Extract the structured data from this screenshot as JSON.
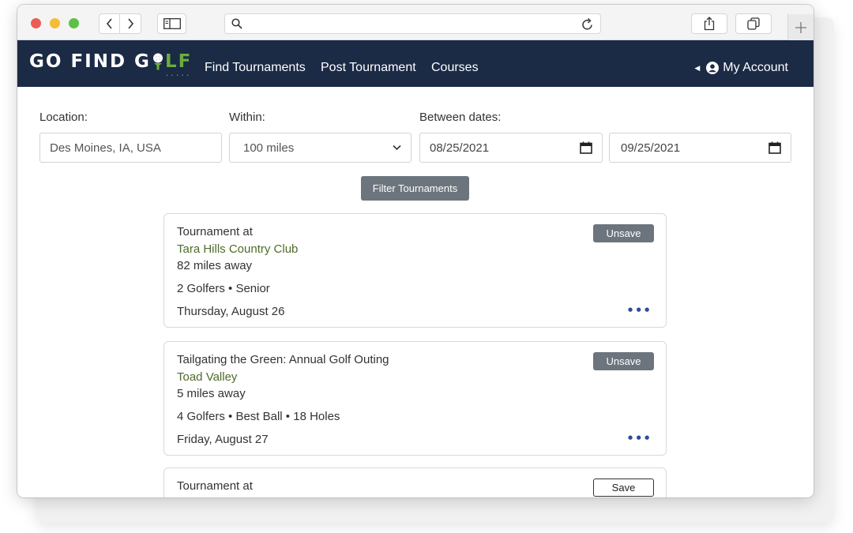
{
  "browser": {
    "icons": [
      "back-icon",
      "forward-icon",
      "sidebar-icon",
      "search-icon",
      "reload-icon",
      "share-icon",
      "tabs-icon",
      "plus-icon"
    ]
  },
  "nav": {
    "logo_part1": "GO FIND G",
    "logo_part2": "LF",
    "links": [
      "Find Tournaments",
      "Post Tournament",
      "Courses"
    ],
    "account": "My Account",
    "colors": {
      "bar": "#1b2a45",
      "logo_accent": "#6aae3e"
    }
  },
  "filters": {
    "location_label": "Location:",
    "location_value": "Des Moines, IA, USA",
    "within_label": "Within:",
    "within_value": "100 miles",
    "dates_label": "Between dates:",
    "start_date": "08/25/2021",
    "end_date": "09/25/2021",
    "button": "Filter Tournaments"
  },
  "tournaments": [
    {
      "title": "Tournament at",
      "course": "Tara Hills Country Club",
      "distance": "82 miles away",
      "meta": "2 Golfers • Senior",
      "date": "Thursday, August 26",
      "action": "Unsave"
    },
    {
      "title": "Tailgating the Green: Annual Golf Outing",
      "course": "Toad Valley",
      "distance": "5 miles away",
      "meta": "4 Golfers • Best Ball • 18 Holes",
      "date": "Friday, August 27",
      "action": "Unsave"
    },
    {
      "title": "Tournament at",
      "action": "Save"
    }
  ]
}
